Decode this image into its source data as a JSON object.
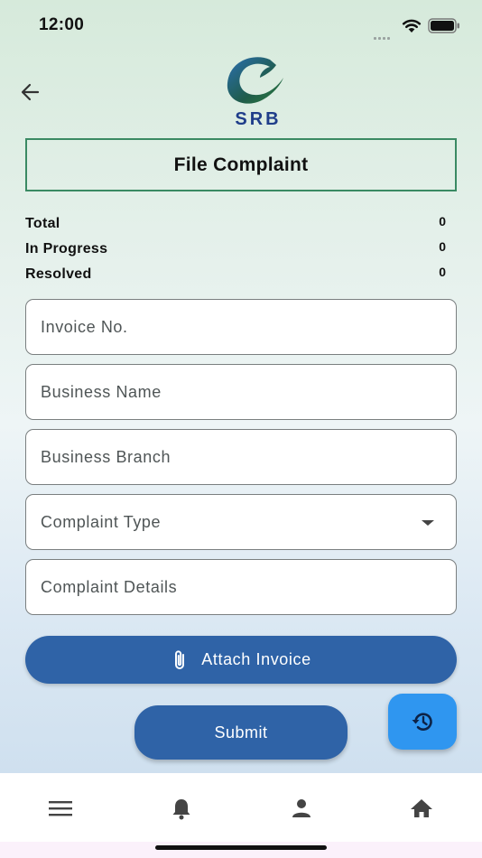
{
  "status_bar": {
    "time": "12:00"
  },
  "header": {
    "logo_text": "SRB",
    "title": "File Complaint"
  },
  "stats": [
    {
      "label": "Total",
      "value": "0"
    },
    {
      "label": "In Progress",
      "value": "0"
    },
    {
      "label": "Resolved",
      "value": "0"
    }
  ],
  "form": {
    "invoice_no": {
      "placeholder": "Invoice No.",
      "value": ""
    },
    "business_name": {
      "placeholder": "Business Name",
      "value": ""
    },
    "business_branch": {
      "placeholder": "Business Branch",
      "value": ""
    },
    "complaint_type": {
      "placeholder": "Complaint Type",
      "value": ""
    },
    "complaint_details": {
      "placeholder": "Complaint Details",
      "value": ""
    }
  },
  "buttons": {
    "attach_invoice": "Attach Invoice",
    "submit": "Submit"
  },
  "icons": {
    "back": "arrow-left-icon",
    "attach": "paperclip-icon",
    "history": "history-icon",
    "nav": [
      "menu-icon",
      "bell-icon",
      "person-icon",
      "home-icon"
    ]
  },
  "colors": {
    "primary": "#2f63a7",
    "fab": "#2f96f0",
    "title_border": "#3a8a63"
  }
}
